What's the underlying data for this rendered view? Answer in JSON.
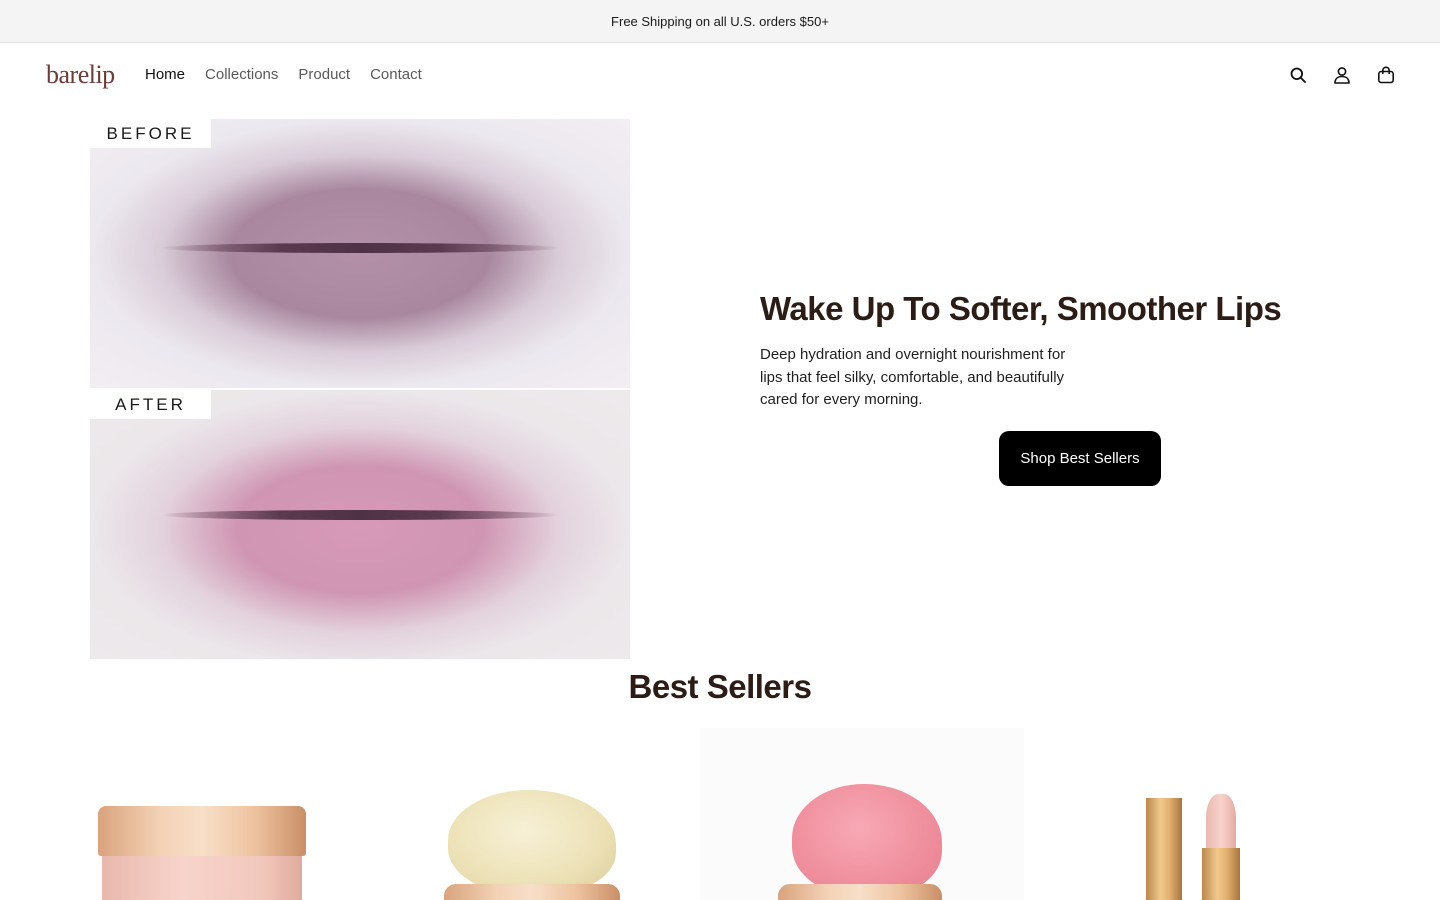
{
  "announcement": {
    "text": "Free Shipping on all U.S. orders $50+"
  },
  "header": {
    "logo": "barelip",
    "nav": [
      {
        "label": "Home",
        "active": true
      },
      {
        "label": "Collections",
        "active": false
      },
      {
        "label": "Product",
        "active": false
      },
      {
        "label": "Contact",
        "active": false
      }
    ],
    "icons": [
      "search-icon",
      "account-icon",
      "cart-icon"
    ]
  },
  "hero": {
    "before_label": "BEFORE",
    "after_label": "AFTER",
    "title": "Wake Up To Softer, Smoother Lips",
    "description": "Deep hydration and overnight nourishment for lips that feel silky, comfortable, and beautifully cared for every morning.",
    "cta": "Shop Best Sellers"
  },
  "best_sellers": {
    "title": "Best Sellers"
  },
  "colors": {
    "accent": "#000000",
    "heading": "#2b1d16",
    "logo": "#6b3d3a",
    "announcement_bg": "#f4f4f4"
  }
}
